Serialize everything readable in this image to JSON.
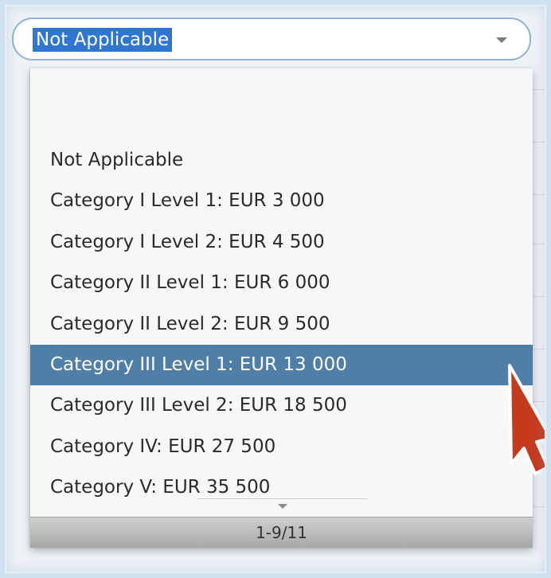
{
  "select": {
    "value": "Not Applicable"
  },
  "dropdown": {
    "options": [
      "Not Applicable",
      "Category I Level 1: EUR 3 000",
      "Category I Level 2: EUR 4 500",
      "Category II Level 1: EUR 6 000",
      "Category II Level 2: EUR 9 500",
      "Category III Level 1: EUR 13 000",
      "Category III Level 2: EUR 18 500",
      "Category IV: EUR 27 500",
      "Category V: EUR 35 500"
    ],
    "highlighted_index": 5,
    "pager": "1-9/11"
  },
  "colors": {
    "highlight": "#4f7ea6",
    "selected_text_bg": "#2f76d2",
    "arrow": "#c63a1c"
  },
  "icons": {
    "caret": "chevron-down-icon",
    "pointer": "red-arrow-icon"
  }
}
